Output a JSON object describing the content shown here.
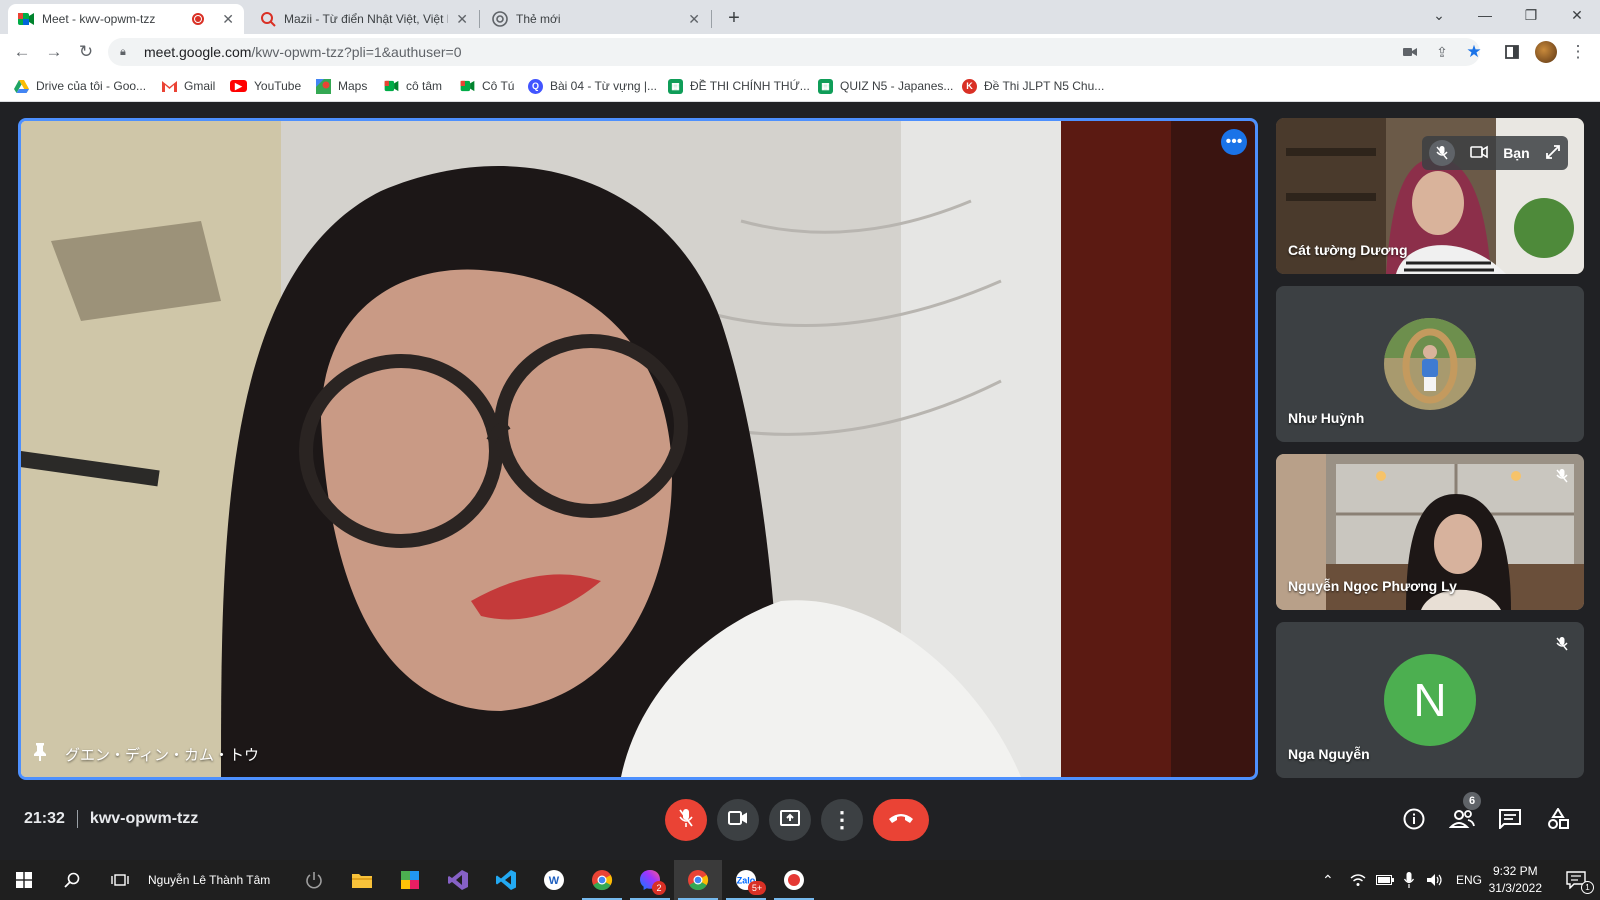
{
  "browser": {
    "tabs": [
      {
        "title": "Meet - kwv-opwm-tzz",
        "favicon": "meet-icon",
        "recording": true,
        "active": true
      },
      {
        "title": "Mazii - Từ điển Nhật Việt, Việt Nh",
        "favicon": "mazii-icon",
        "active": false
      },
      {
        "title": "Thẻ mới",
        "favicon": "chrome-icon",
        "active": false
      }
    ],
    "new_tab_symbol": "+",
    "url_host": "meet.google.com",
    "url_path": "/kwv-opwm-tzz?pli=1&authuser=0",
    "bookmarks": [
      {
        "label": "Drive của tôi - Goo...",
        "icon": "drive-icon",
        "color": "#fbbc04"
      },
      {
        "label": "Gmail",
        "icon": "gmail-icon",
        "color": "#ea4335"
      },
      {
        "label": "YouTube",
        "icon": "youtube-icon",
        "color": "#ff0000"
      },
      {
        "label": "Maps",
        "icon": "maps-icon",
        "color": "#34a853"
      },
      {
        "label": "cô tâm",
        "icon": "meet-icon",
        "color": "#00832d"
      },
      {
        "label": "Cô Tú",
        "icon": "meet-icon",
        "color": "#00832d"
      },
      {
        "label": "Bài 04 - Từ vựng |...",
        "icon": "quizlet-icon",
        "color": "#4255ff"
      },
      {
        "label": "ĐỀ THI CHÍNH THỨ...",
        "icon": "sheets-icon",
        "color": "#0f9d58"
      },
      {
        "label": "QUIZ N5 - Japanes...",
        "icon": "sheets-icon",
        "color": "#0f9d58"
      },
      {
        "label": "Đề Thi JLPT N5 Chu...",
        "icon": "jlpt-icon",
        "color": "#d93025"
      }
    ]
  },
  "meet": {
    "main_participant": "グエン・ディン・カム・トウ",
    "participants": [
      {
        "name": "Cát tường Dương",
        "type": "video",
        "self": true,
        "self_label": "Bạn"
      },
      {
        "name": "Như Huỳnh",
        "type": "photo-avatar"
      },
      {
        "name": "Nguyễn Ngọc Phương Ly",
        "type": "video",
        "muted": true
      },
      {
        "name": "Nga Nguyễn",
        "type": "letter-avatar",
        "initial": "N",
        "avatar_color": "#4caf50",
        "muted": true
      }
    ],
    "time": "21:32",
    "meeting_code": "kwv-opwm-tzz",
    "people_count": "6"
  },
  "taskbar": {
    "user_label": "Nguyễn Lê Thành Tâm",
    "zalo_badge": "5+",
    "messenger_badge": "2",
    "language": "ENG",
    "clock_time": "9:32 PM",
    "clock_date": "31/3/2022",
    "notification_badge": "1"
  }
}
